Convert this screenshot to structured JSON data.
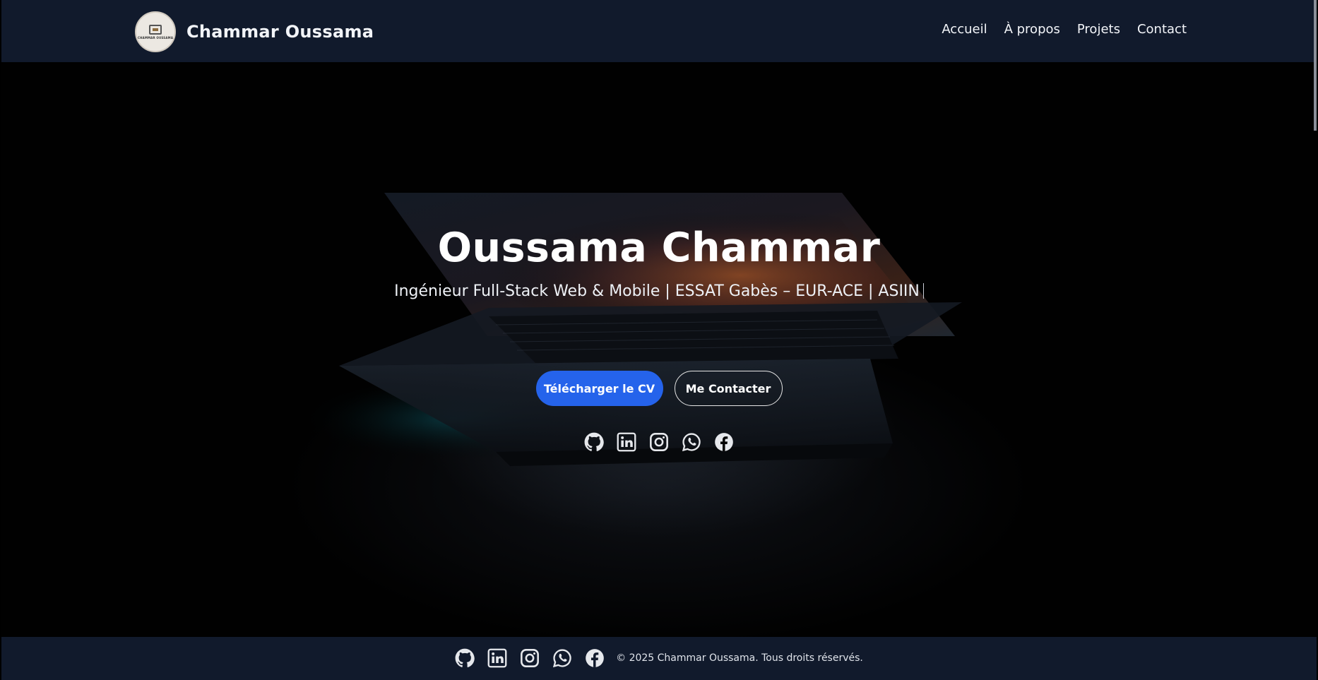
{
  "header": {
    "logo_text": "CHAMMAR OUSSAMA",
    "brand": "Chammar Oussama",
    "nav": [
      {
        "label": "Accueil"
      },
      {
        "label": "À propos"
      },
      {
        "label": "Projets"
      },
      {
        "label": "Contact"
      }
    ]
  },
  "hero": {
    "title": "Oussama Chammar",
    "subtitle": "Ingénieur Full-Stack Web & Mobile | ESSAT Gabès – EUR-ACE | ASIIN",
    "primary_button": "Télécharger le CV",
    "secondary_button": "Me Contacter",
    "socials": [
      "github-icon",
      "linkedin-icon",
      "instagram-icon",
      "whatsapp-icon",
      "facebook-icon"
    ]
  },
  "footer": {
    "copyright": "© 2025 Chammar Oussama. Tous droits réservés.",
    "socials": [
      "github-icon",
      "linkedin-icon",
      "instagram-icon",
      "whatsapp-icon",
      "facebook-icon"
    ]
  },
  "colors": {
    "nav_bg": "#111a2c",
    "accent": "#2563eb",
    "hero_bg": "#010101"
  }
}
